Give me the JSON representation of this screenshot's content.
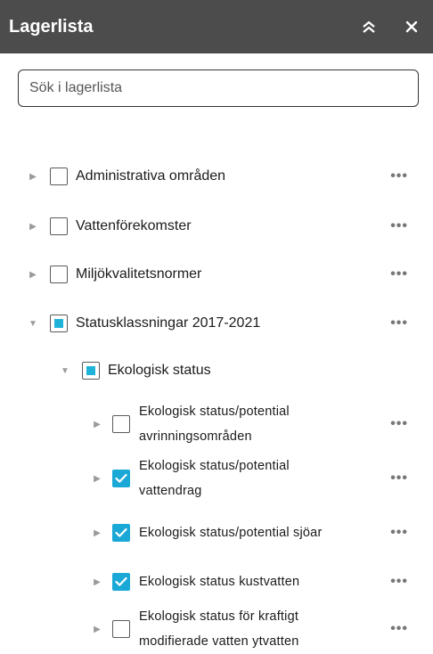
{
  "header": {
    "title": "Lagerlista",
    "collapse_icon": "double-chevron-up-icon",
    "close_icon": "close-icon"
  },
  "search": {
    "placeholder": "Sök i lagerlista",
    "value": ""
  },
  "colors": {
    "header_bg": "#4c4c4c",
    "accent": "#1aa8d6"
  },
  "layers": [
    {
      "label": "Administrativa områden",
      "state": "unchecked",
      "expanded": false,
      "more": "•••"
    },
    {
      "label": "Vattenförekomster",
      "state": "unchecked",
      "expanded": false,
      "more": "•••"
    },
    {
      "label": "Miljökvalitetsnormer",
      "state": "unchecked",
      "expanded": false,
      "more": "•••"
    },
    {
      "label": "Statusklassningar 2017-2021",
      "state": "partial",
      "expanded": true,
      "more": "•••"
    },
    {
      "label": "Ekologisk status",
      "state": "partial",
      "expanded": true,
      "more": ""
    },
    {
      "line1": "Ekologisk status/potential",
      "line2": "avrinningsområden",
      "state": "unchecked",
      "expanded": false,
      "more": "•••"
    },
    {
      "line1": "Ekologisk status/potential",
      "line2": "vattendrag",
      "state": "checked",
      "expanded": false,
      "more": "•••"
    },
    {
      "label": "Ekologisk status/potential sjöar",
      "state": "checked",
      "expanded": false,
      "more": "•••"
    },
    {
      "label": "Ekologisk status kustvatten",
      "state": "checked",
      "expanded": false,
      "more": "•••"
    },
    {
      "line1": "Ekologisk status för kraftigt",
      "line2": "modifierade vatten ytvatten",
      "state": "unchecked",
      "expanded": false,
      "more": "•••"
    }
  ]
}
